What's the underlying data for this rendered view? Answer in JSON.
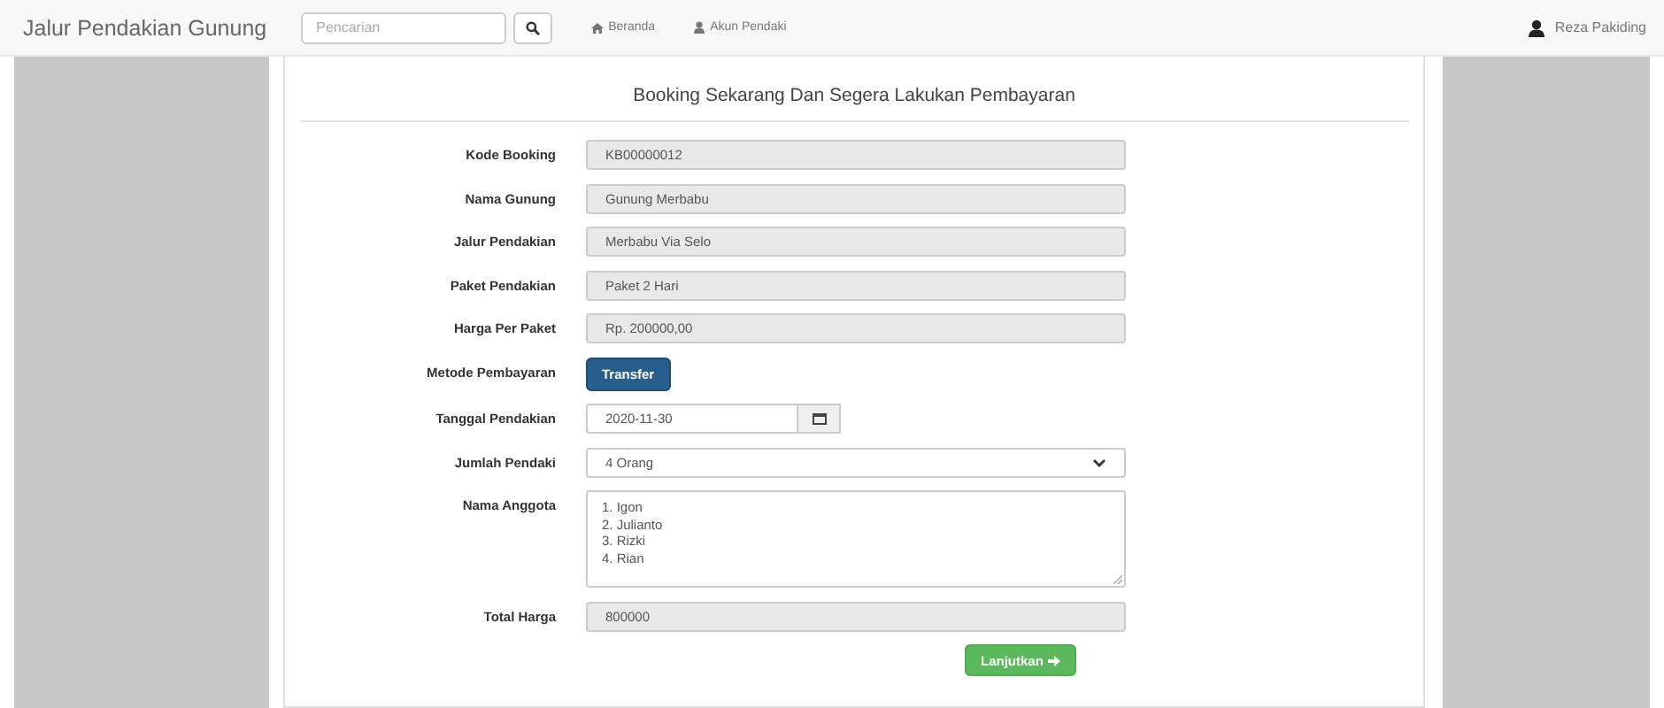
{
  "navbar": {
    "brand": "Jalur Pendakian Gunung",
    "search": {
      "placeholder": "Pencarian"
    },
    "links": [
      {
        "label": "Beranda"
      },
      {
        "label": "Akun Pendaki"
      }
    ],
    "user": "Reza Pakiding"
  },
  "form": {
    "title": "Booking Sekarang Dan Segera Lakukan Pembayaran",
    "rows": [
      {
        "kind": "readonly",
        "label": "Kode Booking",
        "value": "KB00000012"
      },
      {
        "kind": "readonly",
        "label": "Nama Gunung",
        "value": "Gunung Merbabu"
      },
      {
        "kind": "readonly",
        "label": "Jalur Pendakian",
        "value": "Merbabu Via Selo"
      },
      {
        "kind": "readonly",
        "label": "Paket Pendakian",
        "value": "Paket 2 Hari"
      },
      {
        "kind": "readonly",
        "label": "Harga Per Paket",
        "value": "Rp. 200000,00"
      },
      {
        "kind": "button",
        "label": "Metode Pembayaran",
        "value": "Transfer"
      },
      {
        "kind": "date",
        "label": "Tanggal Pendakian",
        "value": "2020-11-30"
      },
      {
        "kind": "select",
        "label": "Jumlah Pendaki",
        "value": "4 Orang"
      },
      {
        "kind": "textarea",
        "label": "Nama Anggota",
        "lines": [
          "1. Igon",
          "2. Julianto",
          "3. Rizki",
          "4. Rian"
        ]
      },
      {
        "kind": "readonly",
        "label": "Total Harga",
        "value": "800000"
      }
    ],
    "submit": "Lanjutkan"
  }
}
